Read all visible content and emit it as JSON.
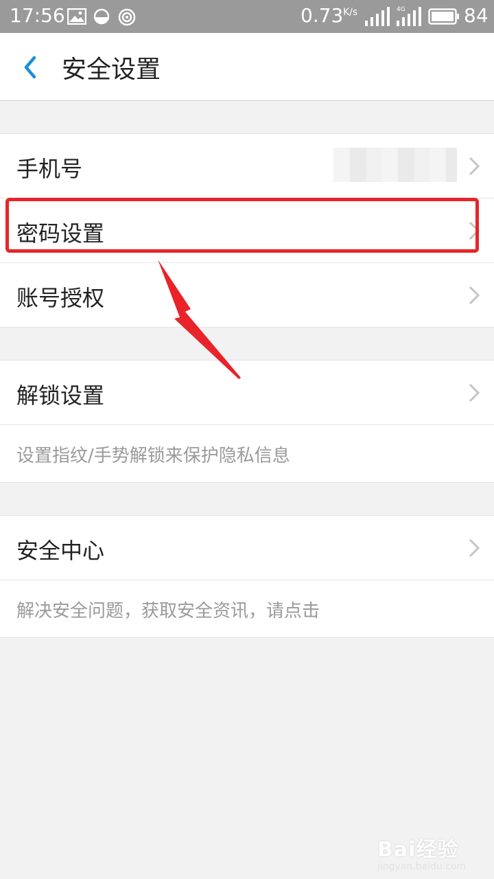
{
  "status_bar": {
    "time": "17:56",
    "speed": "0.73",
    "speed_unit": "K/s",
    "network": "4G",
    "battery": "84",
    "icons": [
      "image-icon",
      "half-circle-icon",
      "radio-wave-icon",
      "signal-icon",
      "signal-4g-icon",
      "battery-icon"
    ]
  },
  "title_bar": {
    "title": "安全设置",
    "back_icon": "chevron-left-icon",
    "accent_color": "#1a8fd6"
  },
  "section1": {
    "items": [
      {
        "label": "手机号",
        "value_hidden": true
      },
      {
        "label": "密码设置",
        "highlighted": true
      },
      {
        "label": "账号授权"
      }
    ]
  },
  "section2": {
    "label": "解锁设置",
    "hint": "设置指纹/手势解锁来保护隐私信息"
  },
  "section3": {
    "label": "安全中心",
    "hint": "解决安全问题，获取安全资讯，请点击"
  },
  "annotation": {
    "box_color": "#e8242a",
    "arrow_color": "#e8242a"
  },
  "watermark": {
    "main": "Bai经验",
    "sub": "jingyan.baidu.com"
  }
}
